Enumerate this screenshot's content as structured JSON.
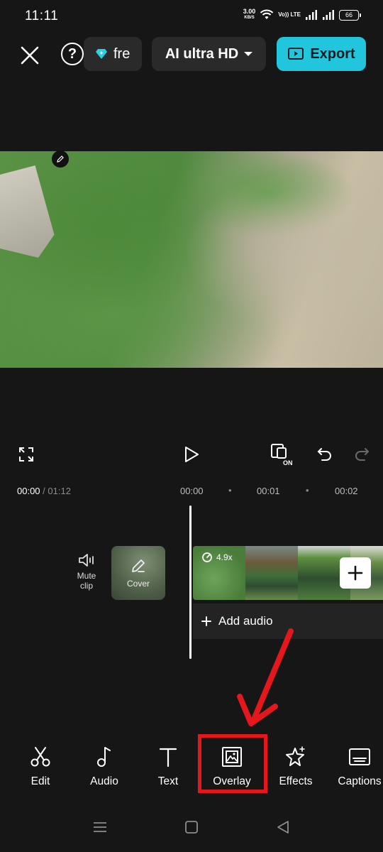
{
  "status": {
    "time": "11:11",
    "net_speed": "3.00",
    "net_unit": "KB/S",
    "volte": "Vo)) LTE",
    "battery": "66"
  },
  "topbar": {
    "pro_label": "fre",
    "quality_label": "AI ultra HD",
    "export_label": "Export"
  },
  "timeline": {
    "current": "00:00",
    "total": "/ 01:12",
    "ticks": [
      "00:00",
      "00:01",
      "00:02"
    ],
    "mute_label": "Mute clip",
    "cover_label": "Cover",
    "speed": "4.9x",
    "add_audio": "Add audio"
  },
  "toolbar": {
    "items": [
      {
        "label": "Edit",
        "icon": "scissors-icon"
      },
      {
        "label": "Audio",
        "icon": "music-note-icon"
      },
      {
        "label": "Text",
        "icon": "text-icon"
      },
      {
        "label": "Overlay",
        "icon": "overlay-icon"
      },
      {
        "label": "Effects",
        "icon": "sparkle-star-icon"
      },
      {
        "label": "Captions",
        "icon": "captions-icon"
      }
    ]
  },
  "colors": {
    "background": "#161616",
    "accent": "#21c6dc",
    "annotation": "#e3171c"
  }
}
